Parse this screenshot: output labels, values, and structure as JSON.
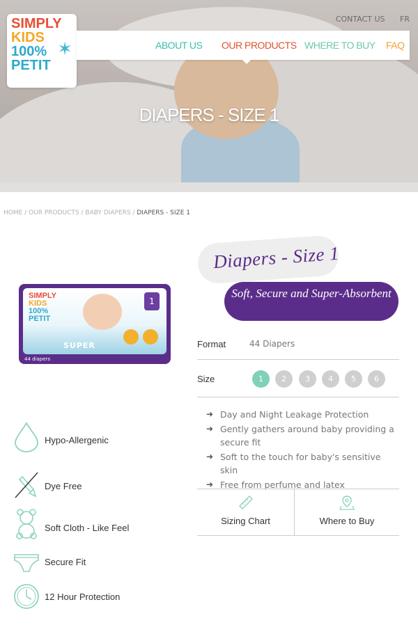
{
  "header": {
    "logo": {
      "line1": "SIMPLY",
      "line2": "KIDS",
      "line3": "100%",
      "line4": "PETIT"
    },
    "top_links": {
      "contact": "CONTACT US",
      "lang": "FR"
    },
    "nav": {
      "about": "ABOUT US",
      "products": "OUR PRODUCTS",
      "where": "WHERE TO BUY",
      "faq": "FAQ"
    },
    "hero_title": "DIAPERS - SIZE 1"
  },
  "breadcrumb": {
    "home": "HOME",
    "products": "OUR PRODUCTS",
    "category": "BABY DIAPERS",
    "current": "DIAPERS - SIZE 1",
    "separator": " / "
  },
  "product": {
    "title": "Diapers - Size 1",
    "subtitle": "Soft, Secure and Super-Absorbent",
    "package": {
      "brand1": "SIMPLY",
      "brand2": "KIDS",
      "brand3": "100%",
      "brand4": "PETIT",
      "type": "SUPER",
      "size": "1",
      "count": "44 diapers"
    },
    "format_label": "Format",
    "format_value": "44 Diapers",
    "size_label": "Size",
    "sizes": [
      "1",
      "2",
      "3",
      "4",
      "5",
      "6"
    ],
    "selected_size": "1",
    "bullets": [
      "Day and Night Leakage Protection",
      "Gently gathers around baby providing a secure fit",
      "Soft to the touch for baby's sensitive skin",
      "Free from perfume and latex"
    ],
    "actions": {
      "sizing": "Sizing Chart",
      "where": "Where to Buy"
    }
  },
  "features": [
    {
      "icon": "droplet-icon",
      "label": "Hypo-Allergenic"
    },
    {
      "icon": "no-dye-icon",
      "label": "Dye Free"
    },
    {
      "icon": "teddy-bear-icon",
      "label": "Soft Cloth - Like Feel"
    },
    {
      "icon": "diaper-icon",
      "label": "Secure Fit"
    },
    {
      "icon": "clock-icon",
      "label": "12 Hour Protection"
    }
  ],
  "colors": {
    "purple": "#5b2d8a",
    "teal": "#7fd1b9",
    "nav_active": "#e0532e",
    "icon_green": "#8fd3bf"
  }
}
